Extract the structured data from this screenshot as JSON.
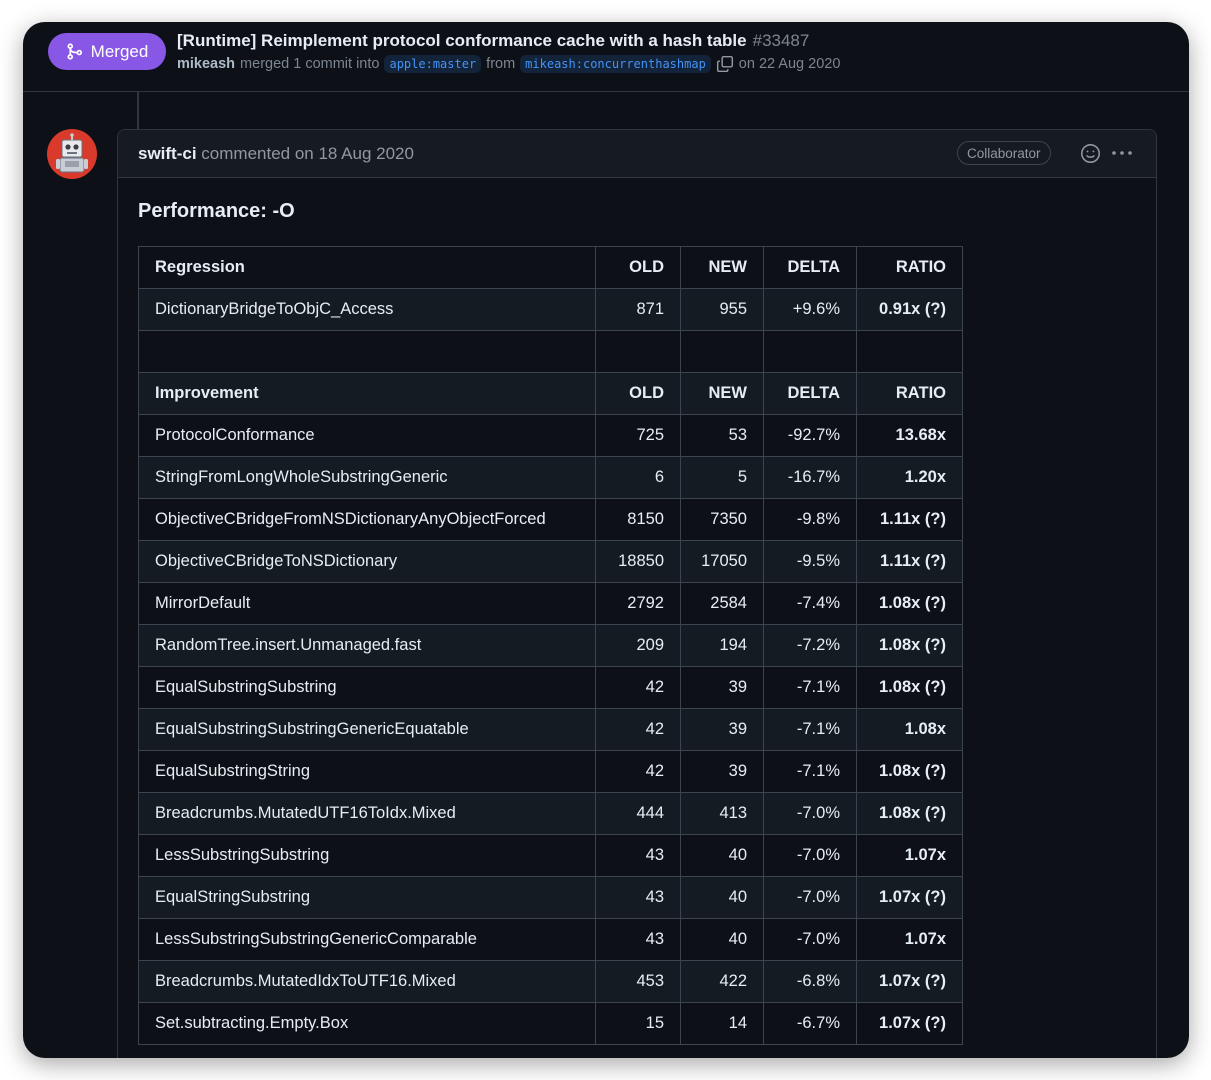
{
  "pr": {
    "status": "Merged",
    "title": "[Runtime] Reimplement protocol conformance cache with a hash table",
    "number": "#33487",
    "author": "mikeash",
    "merged_text": "merged 1 commit into",
    "base_branch": "apple:master",
    "from_text": "from",
    "head_branch": "mikeash:concurrenthashmap",
    "date_text": "on 22 Aug 2020"
  },
  "comment": {
    "author": "swift-ci",
    "when": "commented on 18 Aug 2020",
    "role": "Collaborator",
    "heading": "Performance: -O"
  },
  "table": {
    "regression_header": {
      "label": "Regression",
      "old": "OLD",
      "new": "NEW",
      "delta": "DELTA",
      "ratio": "RATIO"
    },
    "regression_rows": [
      {
        "name": "DictionaryBridgeToObjC_Access",
        "old": "871",
        "new": "955",
        "delta": "+9.6%",
        "ratio": "0.91x (?)"
      }
    ],
    "improvement_header": {
      "label": "Improvement",
      "old": "OLD",
      "new": "NEW",
      "delta": "DELTA",
      "ratio": "RATIO"
    },
    "improvement_rows": [
      {
        "name": "ProtocolConformance",
        "old": "725",
        "new": "53",
        "delta": "-92.7%",
        "ratio": "13.68x"
      },
      {
        "name": "StringFromLongWholeSubstringGeneric",
        "old": "6",
        "new": "5",
        "delta": "-16.7%",
        "ratio": "1.20x"
      },
      {
        "name": "ObjectiveCBridgeFromNSDictionaryAnyObjectForced",
        "old": "8150",
        "new": "7350",
        "delta": "-9.8%",
        "ratio": "1.11x (?)"
      },
      {
        "name": "ObjectiveCBridgeToNSDictionary",
        "old": "18850",
        "new": "17050",
        "delta": "-9.5%",
        "ratio": "1.11x (?)"
      },
      {
        "name": "MirrorDefault",
        "old": "2792",
        "new": "2584",
        "delta": "-7.4%",
        "ratio": "1.08x (?)"
      },
      {
        "name": "RandomTree.insert.Unmanaged.fast",
        "old": "209",
        "new": "194",
        "delta": "-7.2%",
        "ratio": "1.08x (?)"
      },
      {
        "name": "EqualSubstringSubstring",
        "old": "42",
        "new": "39",
        "delta": "-7.1%",
        "ratio": "1.08x (?)"
      },
      {
        "name": "EqualSubstringSubstringGenericEquatable",
        "old": "42",
        "new": "39",
        "delta": "-7.1%",
        "ratio": "1.08x"
      },
      {
        "name": "EqualSubstringString",
        "old": "42",
        "new": "39",
        "delta": "-7.1%",
        "ratio": "1.08x (?)"
      },
      {
        "name": "Breadcrumbs.MutatedUTF16ToIdx.Mixed",
        "old": "444",
        "new": "413",
        "delta": "-7.0%",
        "ratio": "1.08x (?)"
      },
      {
        "name": "LessSubstringSubstring",
        "old": "43",
        "new": "40",
        "delta": "-7.0%",
        "ratio": "1.07x"
      },
      {
        "name": "EqualStringSubstring",
        "old": "43",
        "new": "40",
        "delta": "-7.0%",
        "ratio": "1.07x (?)"
      },
      {
        "name": "LessSubstringSubstringGenericComparable",
        "old": "43",
        "new": "40",
        "delta": "-7.0%",
        "ratio": "1.07x"
      },
      {
        "name": "Breadcrumbs.MutatedIdxToUTF16.Mixed",
        "old": "453",
        "new": "422",
        "delta": "-6.8%",
        "ratio": "1.07x (?)"
      },
      {
        "name": "Set.subtracting.Empty.Box",
        "old": "15",
        "new": "14",
        "delta": "-6.7%",
        "ratio": "1.07x (?)"
      }
    ]
  },
  "icons": {
    "merge": "git-merge-icon",
    "copy": "copy-icon",
    "reaction": "smiley-icon",
    "more": "kebab-menu-icon"
  },
  "colors": {
    "merged_badge": "#8957e5",
    "background": "#0d1117",
    "branch_text": "#4493f8",
    "avatar": "#d93a2b"
  }
}
